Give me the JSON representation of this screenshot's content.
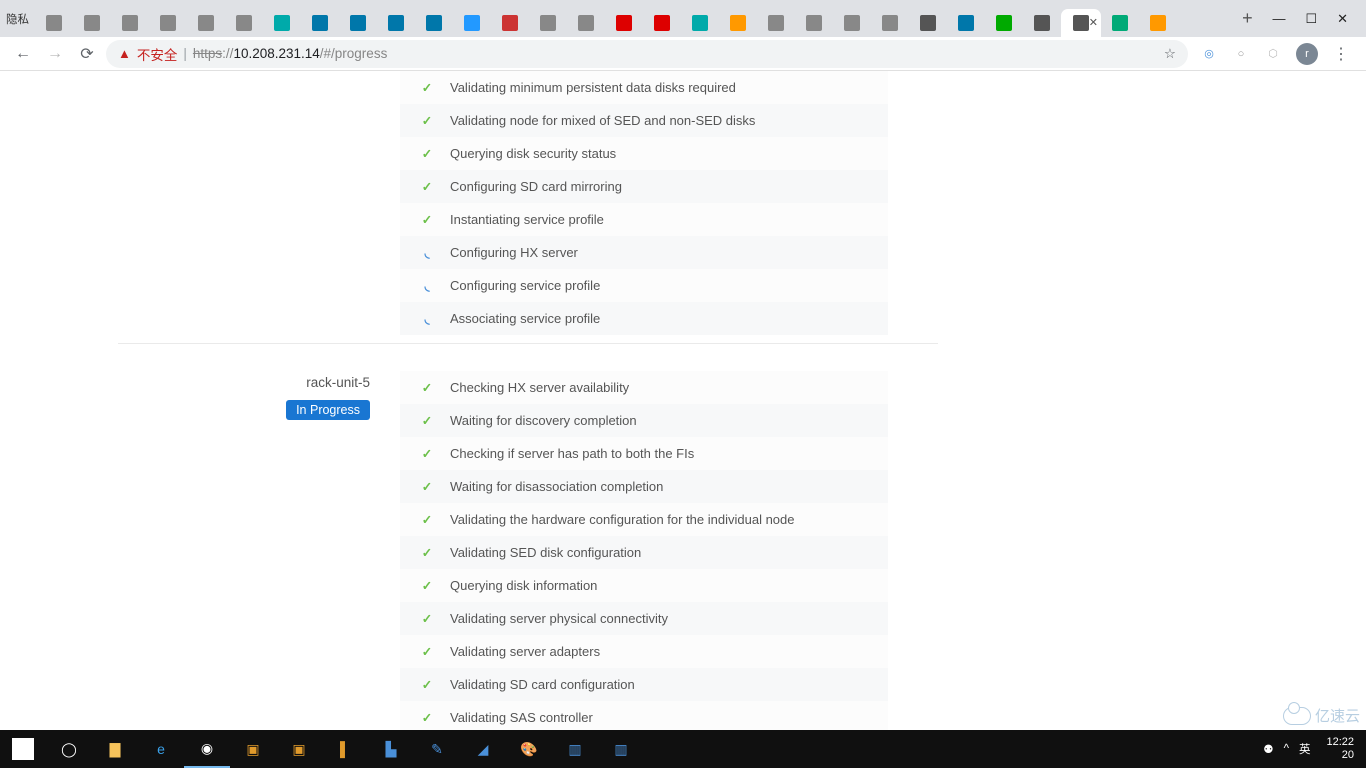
{
  "browser": {
    "incognito_label": "隐私",
    "tabs_count": 30,
    "active_tab_index": 27,
    "newtab_glyph": "+",
    "window_controls": {
      "min": "—",
      "max": "☐",
      "close": "✕"
    }
  },
  "omnibox": {
    "warn_icon": "▲",
    "warn_text": "不安全",
    "sep": "|",
    "scheme": "https",
    "scheme_sep": "://",
    "host": "10.208.231.14",
    "path": "/#/progress",
    "star": "☆"
  },
  "toolbar_icons": {
    "back": "←",
    "forward": "→",
    "reload": "⟳",
    "shield": "◎",
    "flag": "○",
    "ext3": "⬡",
    "avatar_letter": "r",
    "menu": "⋮"
  },
  "page": {
    "group1_tasks": [
      {
        "status": "ok",
        "text": "Validating minimum persistent data disks required"
      },
      {
        "status": "ok",
        "text": "Validating node for mixed of SED and non-SED disks"
      },
      {
        "status": "ok",
        "text": "Querying disk security status"
      },
      {
        "status": "ok",
        "text": "Configuring SD card mirroring"
      },
      {
        "status": "ok",
        "text": "Instantiating service profile"
      },
      {
        "status": "spin",
        "text": "Configuring HX server"
      },
      {
        "status": "spin",
        "text": "Configuring service profile"
      },
      {
        "status": "spin",
        "text": "Associating service profile"
      }
    ],
    "node2": {
      "name": "rack-unit-5",
      "status_label": "In Progress",
      "tasks": [
        {
          "status": "ok",
          "text": "Checking HX server availability"
        },
        {
          "status": "ok",
          "text": "Waiting for discovery completion"
        },
        {
          "status": "ok",
          "text": "Checking if server has path to both the FIs"
        },
        {
          "status": "ok",
          "text": "Waiting for disassociation completion"
        },
        {
          "status": "ok",
          "text": "Validating the hardware configuration for the individual node"
        },
        {
          "status": "ok",
          "text": "Validating SED disk configuration"
        },
        {
          "status": "ok",
          "text": "Querying disk information"
        },
        {
          "status": "ok",
          "text": "Validating server physical connectivity"
        },
        {
          "status": "ok",
          "text": "Validating server adapters"
        },
        {
          "status": "ok",
          "text": "Validating SD card configuration"
        },
        {
          "status": "ok",
          "text": "Validating SAS controller"
        }
      ]
    }
  },
  "status_glyphs": {
    "ok": "✓",
    "spin": "◟"
  },
  "taskbar": {
    "ime": "英",
    "clock_time": "12:22",
    "clock_date": "20",
    "people_icon": "⚉",
    "up_icon": "^"
  },
  "watermark": {
    "text": "亿速云"
  }
}
